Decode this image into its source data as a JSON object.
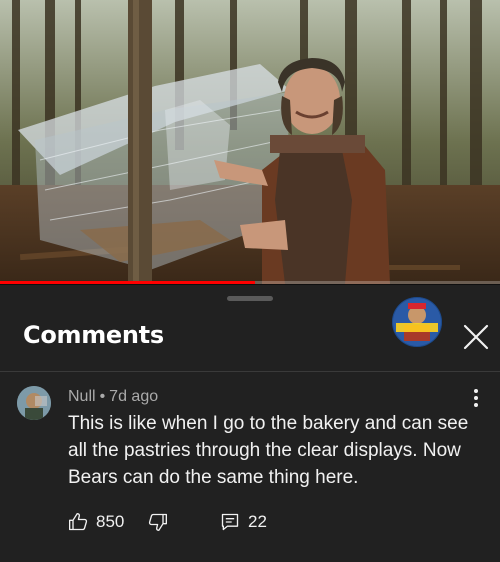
{
  "video": {
    "progress_percent": 51
  },
  "sheet": {
    "title": "Comments",
    "channel_avatar_text": "IE NOSTALGIA",
    "close_icon": "close-icon"
  },
  "comment": {
    "author": "Null",
    "separator": "•",
    "time": "7d ago",
    "text": "This is like when I go to the bakery and can see all the pastries through the clear displays. Now Bears can do the same thing here.",
    "likes": "850",
    "replies": "22",
    "icons": {
      "like": "thumbs-up-icon",
      "dislike": "thumbs-down-icon",
      "reply": "reply-icon",
      "more": "more-vert-icon"
    }
  }
}
